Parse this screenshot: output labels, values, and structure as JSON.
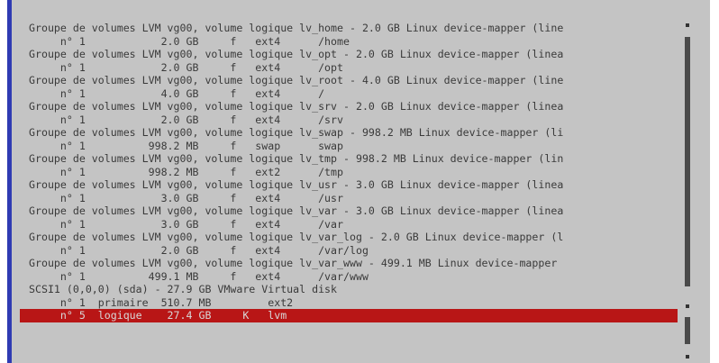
{
  "partition_list": {
    "rows": [
      {
        "text": "Groupe de volumes LVM vg00, volume logique lv_home - 2.0 GB Linux device-mapper (line",
        "selected": false
      },
      {
        "text": "     n° 1            2.0 GB     f   ext4      /home",
        "selected": false
      },
      {
        "text": "Groupe de volumes LVM vg00, volume logique lv_opt - 2.0 GB Linux device-mapper (linea",
        "selected": false
      },
      {
        "text": "     n° 1            2.0 GB     f   ext4      /opt",
        "selected": false
      },
      {
        "text": "Groupe de volumes LVM vg00, volume logique lv_root - 4.0 GB Linux device-mapper (line",
        "selected": false
      },
      {
        "text": "     n° 1            4.0 GB     f   ext4      /",
        "selected": false
      },
      {
        "text": "Groupe de volumes LVM vg00, volume logique lv_srv - 2.0 GB Linux device-mapper (linea",
        "selected": false
      },
      {
        "text": "     n° 1            2.0 GB     f   ext4      /srv",
        "selected": false
      },
      {
        "text": "Groupe de volumes LVM vg00, volume logique lv_swap - 998.2 MB Linux device-mapper (li",
        "selected": false
      },
      {
        "text": "     n° 1          998.2 MB     f   swap      swap",
        "selected": false
      },
      {
        "text": "Groupe de volumes LVM vg00, volume logique lv_tmp - 998.2 MB Linux device-mapper (lin",
        "selected": false
      },
      {
        "text": "     n° 1          998.2 MB     f   ext2      /tmp",
        "selected": false
      },
      {
        "text": "Groupe de volumes LVM vg00, volume logique lv_usr - 3.0 GB Linux device-mapper (linea",
        "selected": false
      },
      {
        "text": "     n° 1            3.0 GB     f   ext4      /usr",
        "selected": false
      },
      {
        "text": "Groupe de volumes LVM vg00, volume logique lv_var - 3.0 GB Linux device-mapper (linea",
        "selected": false
      },
      {
        "text": "     n° 1            3.0 GB     f   ext4      /var",
        "selected": false
      },
      {
        "text": "Groupe de volumes LVM vg00, volume logique lv_var_log - 2.0 GB Linux device-mapper (l",
        "selected": false
      },
      {
        "text": "     n° 1            2.0 GB     f   ext4      /var/log",
        "selected": false
      },
      {
        "text": "Groupe de volumes LVM vg00, volume logique lv_var_www - 499.1 MB Linux device-mapper",
        "selected": false
      },
      {
        "text": "     n° 1          499.1 MB     f   ext4      /var/www",
        "selected": false
      },
      {
        "text": "SCSI1 (0,0,0) (sda) - 27.9 GB VMware Virtual disk",
        "selected": false
      },
      {
        "text": "     n° 1  primaire  510.7 MB         ext2",
        "selected": false
      },
      {
        "text": "     n° 5  logique    27.4 GB     K   lvm",
        "selected": true
      }
    ]
  },
  "colors": {
    "panel_bg": "#c4c4c4",
    "text": "#3a3a3a",
    "selection_bg": "#b81616",
    "selection_text": "#d8d8d8",
    "border_blue": "#2f3bb3",
    "scrollbar": "#4a4a4a"
  },
  "scrollbar": {
    "position_fraction": 0.05,
    "visible_fraction": 0.88
  }
}
